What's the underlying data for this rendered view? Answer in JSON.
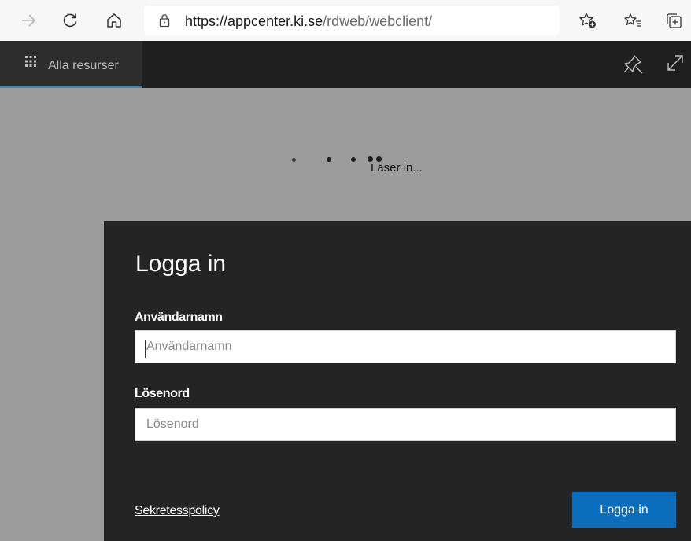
{
  "browser": {
    "url_host": "https://appcenter.ki.se",
    "url_path": "/rdweb/webclient/"
  },
  "app_bar": {
    "tab_label": "Alla resurser"
  },
  "loading": {
    "text": "Läser in..."
  },
  "login": {
    "title": "Logga in",
    "username_label": "Användarnamn",
    "username_placeholder": "Användarnamn",
    "username_value": "",
    "password_label": "Lösenord",
    "password_placeholder": "Lösenord",
    "password_value": "",
    "privacy_link": "Sekretesspolicy",
    "submit_label": "Logga in"
  },
  "colors": {
    "page_background": "#9c9c9c",
    "app_bar": "#1f1f1f",
    "login_panel": "#242424",
    "accent_button": "#0a6ebd",
    "active_tab_underline": "#4a7fb0"
  },
  "icons": [
    "forward-icon",
    "refresh-icon",
    "home-icon",
    "lock-icon",
    "add-favorite-icon",
    "favorites-icon",
    "collections-icon",
    "grid-icon",
    "pin-icon",
    "expand-icon"
  ]
}
